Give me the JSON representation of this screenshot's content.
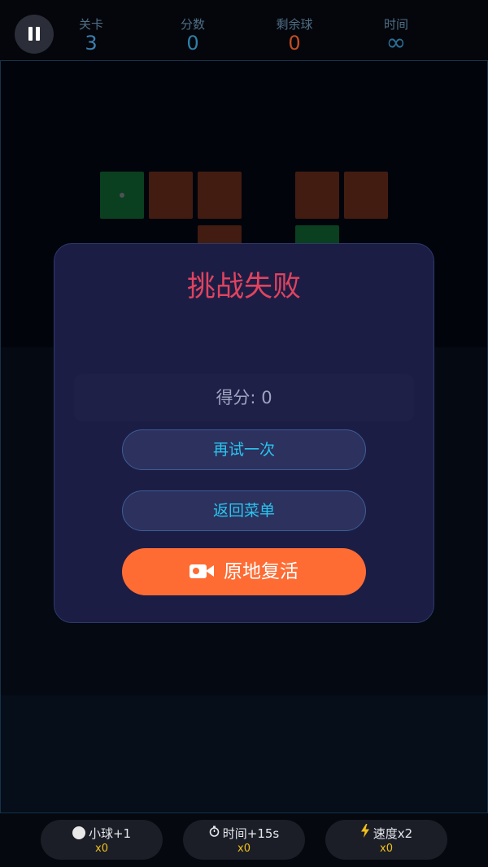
{
  "hud": {
    "level_label": "关卡",
    "level_value": "3",
    "score_label": "分数",
    "score_value": "0",
    "balls_label": "剩余球",
    "balls_value": "0",
    "time_label": "时间",
    "time_value": "∞",
    "colors": {
      "level": "#3a7fb0",
      "score": "#2f7fa9",
      "balls": "#c24d23",
      "time": "#2b6f96"
    }
  },
  "bricks": {
    "colors": {
      "green": "#0c4b25",
      "red": "#4f2214"
    }
  },
  "dialog": {
    "title": "挑战失败",
    "score_text": "得分: 0",
    "retry_label": "再试一次",
    "menu_label": "返回菜单",
    "revive_label": "原地复活",
    "revive_icon": "video-camera-icon"
  },
  "powerups": [
    {
      "icon": "ball-icon",
      "label": "小球+1",
      "count": "x0"
    },
    {
      "icon": "stopwatch-icon",
      "label": "时间+15s",
      "count": "x0"
    },
    {
      "icon": "lightning-icon",
      "label": "速度x2",
      "count": "x0"
    }
  ],
  "accent": {
    "title": "#e0435f",
    "button_text": "#29c4ef",
    "revive_bg": "#ff6c33",
    "count": "#f2c01c"
  }
}
